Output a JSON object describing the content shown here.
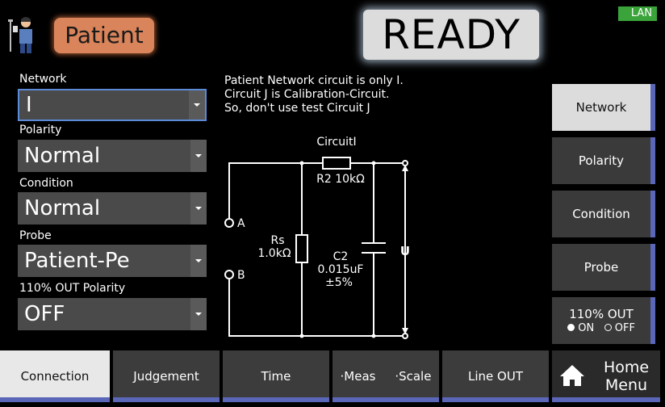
{
  "header": {
    "mode": "Patient",
    "status": "READY",
    "lan": "LAN"
  },
  "fields": {
    "network_label": "Network",
    "network_value": "I",
    "polarity_label": "Polarity",
    "polarity_value": "Normal",
    "condition_label": "Condition",
    "condition_value": "Normal",
    "probe_label": "Probe",
    "probe_value": "Patient-Pe",
    "out110_label": "110% OUT Polarity",
    "out110_value": "OFF"
  },
  "note": {
    "line1": "Patient Network circuit is only I.",
    "line2": "Circuit J is Calibration-Circuit.",
    "line3": "So, don't use test Circuit J"
  },
  "circuit": {
    "title": "CircuitI",
    "r2": "R2 10kΩ",
    "rs_name": "Rs",
    "rs_value": "1.0kΩ",
    "c2_name": "C2",
    "c2_value": "0.015uF",
    "c2_tol": "±5%",
    "node_a": "A",
    "node_b": "B",
    "u": "U"
  },
  "side": {
    "network": "Network",
    "polarity": "Polarity",
    "condition": "Condition",
    "probe": "Probe",
    "out110": "110% OUT",
    "on": "ON",
    "off": "OFF"
  },
  "tabs": {
    "connection": "Connection",
    "judgement": "Judgement",
    "time": "Time",
    "meas": "·Meas",
    "scale": "·Scale",
    "line_out": "Line OUT",
    "home1": "Home",
    "home2": "Menu"
  },
  "colors": {
    "accent": "#5a66b8",
    "mode_pill": "#d9845a",
    "lan": "#3aa33a"
  }
}
